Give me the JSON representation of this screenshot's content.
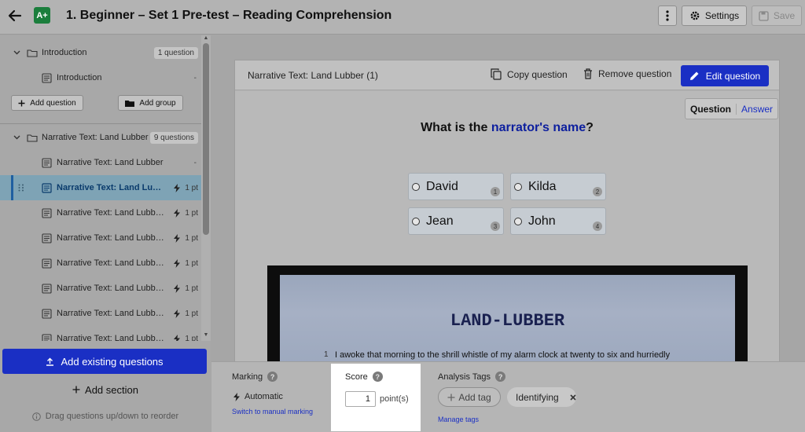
{
  "topbar": {
    "title": "1. Beginner – Set 1 Pre-test – Reading Comprehension",
    "app_badge": "A+",
    "settings_label": "Settings",
    "save_label": "Save"
  },
  "sidebar": {
    "sections": [
      {
        "label": "Introduction",
        "count": "1 question"
      },
      {
        "label": "Narrative Text: Land Lubber",
        "count": "9 questions"
      }
    ],
    "items": [
      {
        "label": "Introduction",
        "meta": "-"
      },
      {
        "label": "Narrative Text: Land Lubber",
        "meta": "-"
      },
      {
        "label": "Narrative Text: Land Lubb...",
        "meta": "1 pt"
      },
      {
        "label": "Narrative Text: Land Lubber...",
        "meta": "1 pt"
      },
      {
        "label": "Narrative Text: Land Lubber...",
        "meta": "1 pt"
      },
      {
        "label": "Narrative Text: Land Lubber...",
        "meta": "1 pt"
      },
      {
        "label": "Narrative Text: Land Lubber...",
        "meta": "1 pt"
      },
      {
        "label": "Narrative Text: Land Lubber...",
        "meta": "1 pt"
      },
      {
        "label": "Narrative Text: Land Lubber...",
        "meta": "1 pt"
      }
    ],
    "add_question_label": "Add question",
    "add_group_label": "Add group",
    "add_existing_label": "Add existing questions",
    "add_section_label": "Add section",
    "drag_hint": "Drag questions up/down to reorder"
  },
  "question_card": {
    "title": "Narrative Text: Land Lubber (1)",
    "copy_label": "Copy question",
    "remove_label": "Remove question",
    "edit_label": "Edit question",
    "toggle": {
      "question": "Question",
      "answer": "Answer"
    },
    "prompt_pre": "What is the ",
    "prompt_highlight": "narrator's name",
    "prompt_post": "?",
    "options": [
      {
        "label": "David",
        "num": "1"
      },
      {
        "label": "Kilda",
        "num": "2"
      },
      {
        "label": "Jean",
        "num": "3"
      },
      {
        "label": "John",
        "num": "4"
      }
    ],
    "passage_title": "LAND-LUBBER",
    "passage_line_num": "1",
    "passage_line": "I awoke that morning to the shrill whistle of my alarm clock at twenty to six and hurriedly"
  },
  "bottom": {
    "marking_title": "Marking",
    "marking_value": "Automatic",
    "marking_link": "Switch to manual marking",
    "score_title": "Score",
    "score_value": "1",
    "score_unit": "point(s)",
    "tags_title": "Analysis Tags",
    "add_tag_label": "Add tag",
    "tags": [
      "Identifying"
    ],
    "manage_tags_link": "Manage tags"
  },
  "colors": {
    "accent": "#1a2fc4",
    "app_logo": "#1b7e3c",
    "selected_row": "#7ea3b5",
    "highlight_text": "#0d1f9e"
  }
}
